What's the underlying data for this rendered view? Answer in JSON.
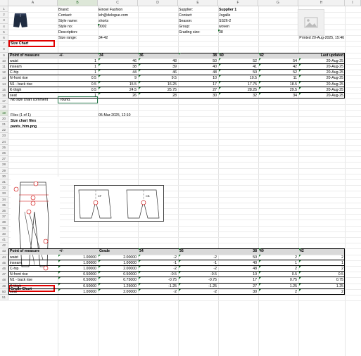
{
  "columns": [
    "A",
    "B",
    "C",
    "D",
    "E",
    "F",
    "G",
    "H",
    "I"
  ],
  "rows": [
    "1",
    "2",
    "3",
    "4",
    "5",
    "6",
    "7",
    "8",
    "9",
    "10",
    "11",
    "12",
    "13",
    "14",
    "15",
    "16",
    "17",
    "18",
    "19",
    "20",
    "21",
    "22",
    "23",
    "24",
    "25",
    "26",
    "27",
    "28",
    "29",
    "30",
    "31",
    "32",
    "33",
    "34",
    "35",
    "36",
    "37",
    "38",
    "39",
    "40",
    "41",
    "42",
    "43",
    "44",
    "45",
    "46",
    "47",
    "48",
    "49",
    "50",
    "51"
  ],
  "header": {
    "brand_label": "Brand:",
    "brand_value": "Einoel Fashion",
    "contact_label": "Contact:",
    "contact_value": "leh@delogue.com",
    "stylename_label": "Style name:",
    "stylename_value": "shorts",
    "styleno_label": "Style no:",
    "styleno_value": "0002",
    "description_label": "Description:",
    "sizerange_label": "Size range:",
    "sizerange_value": "34-42",
    "supplier_label": "Supplier:",
    "supplier_value": "Supplier 1",
    "scontact_label": "Contact:",
    "scontact_value": "Jogalle",
    "season_label": "Season:",
    "season_value": "SS26-2",
    "group_label": "Group:",
    "group_value": "woven",
    "gradingsize_label": "Grading size:",
    "gradingsize_value": "38",
    "printed": "Printed 20-Aug-2025, 15:46"
  },
  "size_chart": {
    "title": "Size Chart",
    "headers": [
      "Point of measure",
      "+/-",
      "34",
      "36",
      "38",
      "40",
      "42",
      "Last updated"
    ],
    "rows": [
      [
        "waist",
        "1",
        "46",
        "48",
        "50",
        "52",
        "54",
        "20-Aug-25"
      ],
      [
        "inseam",
        "1",
        "38",
        "39",
        "40",
        "41",
        "42",
        "20-Aug-25"
      ],
      [
        "C-hip",
        "1",
        "44",
        "46",
        "48",
        "50",
        "52",
        "20-Aug-25"
      ],
      [
        "N-front rise",
        "0.5",
        "9",
        "9.5",
        "10",
        "10.5",
        "11",
        "20-Aug-25"
      ],
      [
        "N1 - back rise",
        "0.5",
        "15.5",
        "16.25",
        "17",
        "17.75",
        "18.5",
        "20-Aug-25"
      ],
      [
        "K-thigh",
        "0.5",
        "24.5",
        "25.75",
        "27",
        "28.25",
        "29.5",
        "20-Aug-25"
      ],
      [
        "seat",
        "1",
        "26",
        "28",
        "30",
        "32",
        "34",
        "20-Aug-25"
      ]
    ]
  },
  "comment": {
    "label": "No size chart comment",
    "value": "found."
  },
  "files": {
    "count": "Files (1 of 1)",
    "date": "05-Mar-2025, 12:10",
    "section": "Size chart files",
    "filename": "pants_htm.png"
  },
  "sketch_labels": {
    "cf": "CF",
    "cb": "CB"
  },
  "grade_chart": {
    "title": "Grade Chart",
    "headers": [
      "Point of measure",
      "+/-",
      "Grade",
      "34",
      "36",
      "38",
      "40",
      "42"
    ],
    "rows": [
      [
        "waist",
        "1.00000",
        "2.00000",
        "-2",
        "-2",
        "50",
        "2",
        "2"
      ],
      [
        "inseam",
        "1.00000",
        "1.00000",
        "-1",
        "-1",
        "40",
        "1",
        "1"
      ],
      [
        "C-hip",
        "1.00000",
        "2.00000",
        "-2",
        "-2",
        "48",
        "2",
        "2"
      ],
      [
        "N-front rise",
        "0.50000",
        "0.50000",
        "-0.5",
        "-0.5",
        "10",
        "0.5",
        "0.5"
      ],
      [
        "N1 - back rise",
        "0.50000",
        "0.75000",
        "-0.75",
        "-0.75",
        "17",
        "0.75",
        "0.75"
      ],
      [
        "K-thigh",
        "0.50000",
        "1.25000",
        "-1.25",
        "-1.25",
        "27",
        "1.25",
        "1.25"
      ],
      [
        "seat",
        "1.00000",
        "2.00000",
        "-2",
        "-2",
        "30",
        "2",
        "2"
      ]
    ]
  },
  "colors": {
    "red_box": "#e00000",
    "header_fill": "#d9d9d9",
    "note_marker": "#1e7a32"
  }
}
